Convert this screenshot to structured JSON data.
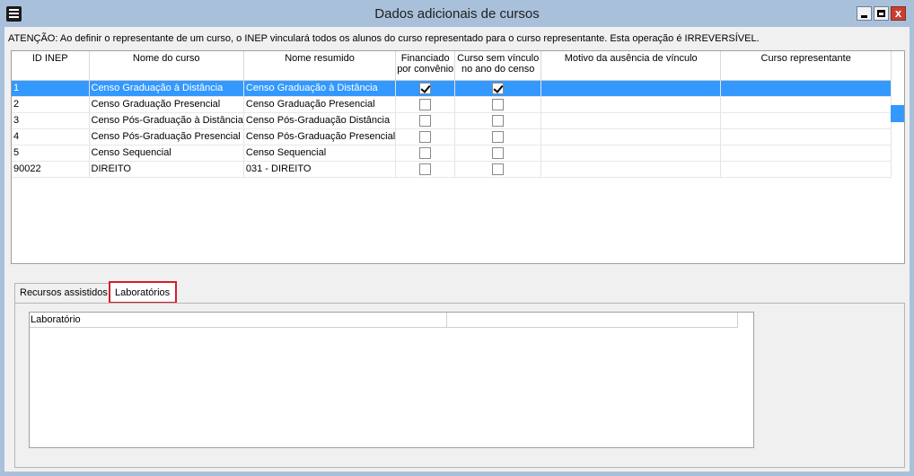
{
  "window": {
    "title": "Dados adicionais de cursos",
    "close_label": "x"
  },
  "warning": "ATENÇÃO: Ao definir o representante de um curso, o INEP vinculará todos os alunos do curso representado para o curso representante. Esta operação é IRREVERSÍVEL.",
  "grid": {
    "columns": [
      "ID INEP",
      "Nome do curso",
      "Nome resumido",
      "Financiado por convênio",
      "Curso sem vínculo no ano do censo",
      "Motivo da ausência de vínculo",
      "Curso representante"
    ],
    "rows": [
      {
        "id": "1",
        "nome": "Censo Graduação à Distância",
        "resumido": "Censo Graduação à Distância",
        "financiado": true,
        "sem_vinculo": true,
        "motivo": "",
        "representante": ""
      },
      {
        "id": "2",
        "nome": "Censo Graduação Presencial",
        "resumido": "Censo Graduação Presencial",
        "financiado": false,
        "sem_vinculo": false,
        "motivo": "",
        "representante": ""
      },
      {
        "id": "3",
        "nome": "Censo Pós-Graduação à Distância",
        "resumido": "Censo Pós-Graduação Distância",
        "financiado": false,
        "sem_vinculo": false,
        "motivo": "",
        "representante": ""
      },
      {
        "id": "4",
        "nome": "Censo Pós-Graduação Presencial",
        "resumido": "Censo Pós-Graduação Presencial",
        "financiado": false,
        "sem_vinculo": false,
        "motivo": "",
        "representante": ""
      },
      {
        "id": "5",
        "nome": "Censo Sequencial",
        "resumido": "Censo Sequencial",
        "financiado": false,
        "sem_vinculo": false,
        "motivo": "",
        "representante": ""
      },
      {
        "id": "90022",
        "nome": "DIREITO",
        "resumido": "031 - DIREITO",
        "financiado": false,
        "sem_vinculo": false,
        "motivo": "",
        "representante": ""
      }
    ],
    "selected_row": 0
  },
  "tabs": [
    "Recursos assistidos",
    "Laboratórios"
  ],
  "active_tab": 1,
  "lab_grid": {
    "columns": [
      "Laboratório",
      ""
    ]
  },
  "colors": {
    "titlebar": "#a9c0da",
    "selection": "#3399ff",
    "active_tab_outline": "#d0202a"
  }
}
